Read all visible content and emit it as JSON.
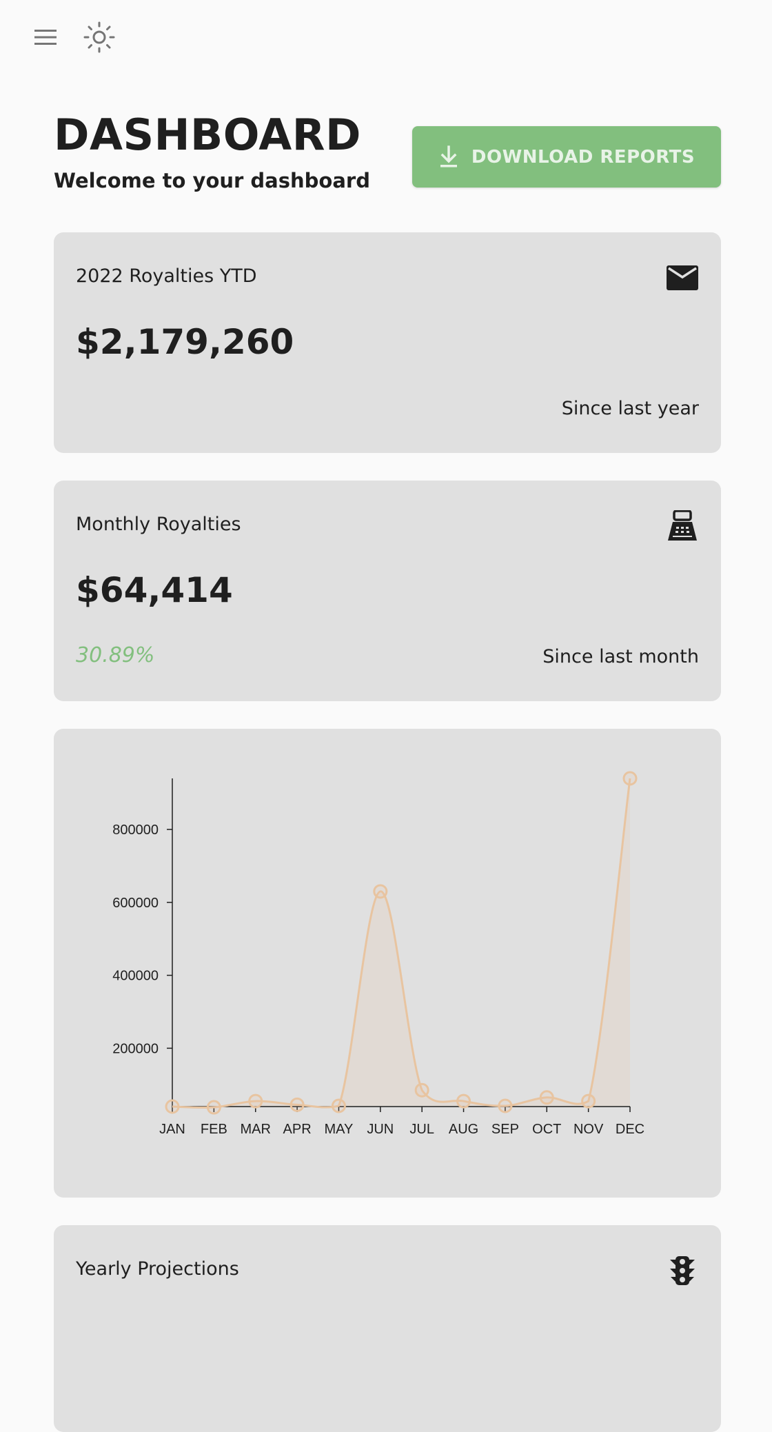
{
  "topbar": {
    "menu_icon": "hamburger-menu-icon",
    "theme_icon": "sun-icon"
  },
  "header": {
    "title": "DASHBOARD",
    "subtitle": "Welcome to your dashboard",
    "download_label": "DOWNLOAD REPORTS",
    "download_icon": "download-icon"
  },
  "colors": {
    "background": "#fafafa",
    "card": "#e0e0e0",
    "accent_green": "#82bf7e",
    "line": "#e8c4a0",
    "text": "#1f1f1f"
  },
  "cards": {
    "ytd": {
      "label": "2022 Royalties YTD",
      "value": "$2,179,260",
      "since": "Since last year",
      "icon": "email-icon"
    },
    "monthly": {
      "label": "Monthly Royalties",
      "value": "$64,414",
      "change": "30.89%",
      "since": "Since last month",
      "icon": "fax-icon"
    },
    "projections": {
      "label": "Yearly Projections",
      "icon": "traffic-light-icon"
    }
  },
  "chart_data": {
    "type": "line",
    "style": "smooth area with circle markers",
    "x": [
      "JAN",
      "FEB",
      "MAR",
      "APR",
      "MAY",
      "JUN",
      "JUL",
      "AUG",
      "SEP",
      "OCT",
      "NOV",
      "DEC"
    ],
    "series": [
      {
        "values": [
          40000,
          38000,
          55000,
          45000,
          42000,
          630000,
          85000,
          55000,
          42000,
          65000,
          55000,
          940000
        ]
      }
    ],
    "y_ticks": [
      200000,
      400000,
      600000,
      800000
    ],
    "ylim": [
      40000,
      940000
    ],
    "grid": false
  }
}
